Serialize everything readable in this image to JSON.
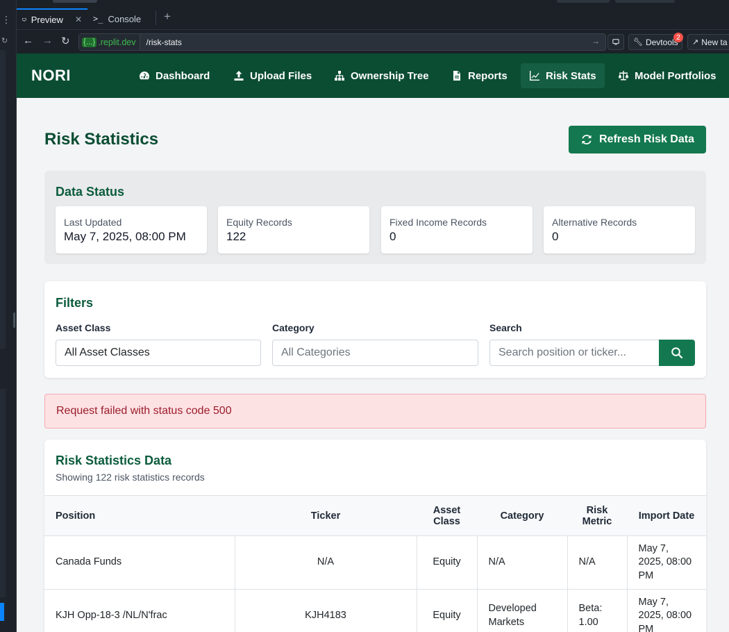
{
  "browser": {
    "tabs": [
      {
        "label": "Preview",
        "icon": "monitor-icon"
      },
      {
        "label": "Console",
        "icon": "terminal-icon"
      }
    ],
    "url_host_brace": "{...}",
    "url_host": ".replit.dev",
    "url_path": "/risk-stats",
    "devtools_label": "Devtools",
    "devtools_badge": "2",
    "new_tab_label": "New ta"
  },
  "app": {
    "brand": "NORI",
    "nav": [
      {
        "label": "Dashboard",
        "icon": "gauge-icon"
      },
      {
        "label": "Upload Files",
        "icon": "upload-icon"
      },
      {
        "label": "Ownership Tree",
        "icon": "sitemap-icon"
      },
      {
        "label": "Reports",
        "icon": "file-icon"
      },
      {
        "label": "Risk Stats",
        "icon": "chart-line-icon",
        "active": true
      },
      {
        "label": "Model Portfolios",
        "icon": "scale-icon"
      }
    ]
  },
  "page": {
    "title": "Risk Statistics",
    "refresh_label": "Refresh Risk Data"
  },
  "data_status": {
    "title": "Data Status",
    "cards": [
      {
        "label": "Last Updated",
        "value": "May 7, 2025, 08:00 PM"
      },
      {
        "label": "Equity Records",
        "value": "122"
      },
      {
        "label": "Fixed Income Records",
        "value": "0"
      },
      {
        "label": "Alternative Records",
        "value": "0"
      }
    ]
  },
  "filters": {
    "title": "Filters",
    "asset_class_label": "Asset Class",
    "asset_class_value": "All Asset Classes",
    "category_label": "Category",
    "category_placeholder": "All Categories",
    "search_label": "Search",
    "search_placeholder": "Search position or ticker..."
  },
  "error": {
    "message": "Request failed with status code 500"
  },
  "risk_data": {
    "title": "Risk Statistics Data",
    "subtitle": "Showing 122 risk statistics records",
    "headers": [
      "Position",
      "Ticker",
      "Asset Class",
      "Category",
      "Risk Metric",
      "Import Date"
    ],
    "rows": [
      {
        "position": "Canada Funds",
        "ticker": "N/A",
        "asset_class": "Equity",
        "category": "N/A",
        "risk_metric": "N/A",
        "import_date": "May 7, 2025, 08:00 PM"
      },
      {
        "position": "KJH Opp-18-3 /NL/N'frac",
        "ticker": "KJH4183",
        "asset_class": "Equity",
        "category": "Developed Markets",
        "risk_metric": "Beta: 1.00",
        "import_date": "May 7, 2025, 08:00 PM"
      }
    ]
  },
  "colors": {
    "nav_bg": "#0b4d33",
    "accent": "#13784f",
    "error_bg": "#fde2e4",
    "error_text": "#9b1c2a"
  }
}
